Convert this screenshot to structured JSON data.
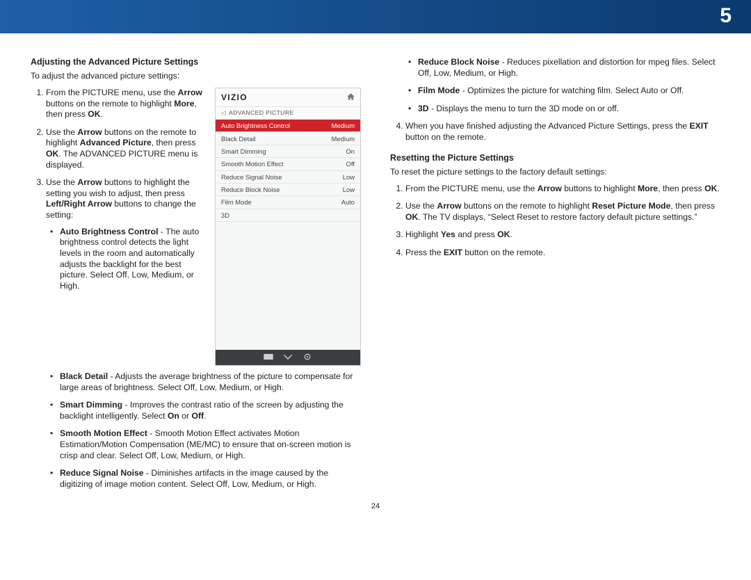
{
  "header": {
    "chapter_number": "5"
  },
  "page_number": "24",
  "screen": {
    "brand": "VIZIO",
    "crumb": "ADVANCED PICTURE",
    "rows": [
      {
        "label": "Auto Brightness Control",
        "value": "Medium",
        "selected": true
      },
      {
        "label": "Black Detail",
        "value": "Medium",
        "selected": false
      },
      {
        "label": "Smart Dimming",
        "value": "On",
        "selected": false
      },
      {
        "label": "Smooth Motion Effect",
        "value": "Off",
        "selected": false
      },
      {
        "label": "Reduce Signal Noise",
        "value": "Low",
        "selected": false
      },
      {
        "label": "Reduce Block Noise",
        "value": "Low",
        "selected": false
      },
      {
        "label": "Film Mode",
        "value": "Auto",
        "selected": false
      },
      {
        "label": "3D",
        "value": "",
        "selected": false
      }
    ]
  },
  "left": {
    "title": "Adjusting the Advanced Picture Settings",
    "intro": "To adjust the advanced picture settings:",
    "step1_a": "From the PICTURE menu, use the ",
    "step1_b": "Arrow",
    "step1_c": " buttons on the remote to highlight ",
    "step1_d": "More",
    "step1_e": ", then press ",
    "step1_f": "OK",
    "step1_g": ".",
    "step2_a": "Use the ",
    "step2_b": "Arrow",
    "step2_c": " buttons on the remote to highlight ",
    "step2_d": "Advanced Picture",
    "step2_e": ", then press ",
    "step2_f": "OK",
    "step2_g": ". The ADVANCED PICTURE menu is displayed.",
    "step3_a": "Use the ",
    "step3_b": "Arrow",
    "step3_c": " buttons to highlight the setting you wish to adjust, then press ",
    "step3_d": "Left/Right Arrow",
    "step3_e": " buttons to change the setting:",
    "opt1_h": "Auto Brightness Control",
    "opt1_t": " - The auto brightness control detects the light levels in the room and automatically adjusts the backlight for the best picture. Select Off, Low, Medium, or High.",
    "opt2_h": "Black Detail",
    "opt2_t": " - Adjusts the average brightness of the picture to compensate for large areas of brightness. Select Off, Low, Medium, or High.",
    "opt3_h": "Smart Dimming",
    "opt3_t1": " - Improves the contrast ratio of the screen by adjusting the backlight intelligently. Select ",
    "opt3_on": "On",
    "opt3_or": " or ",
    "opt3_off": "Off",
    "opt3_t2": ".",
    "opt4_h": "Smooth Motion Effect",
    "opt4_t": " - Smooth Motion Effect activates Motion Estimation/Motion Compensation (ME/MC) to ensure that on-screen motion is crisp and clear. Select Off, Low, Medium, or High.",
    "opt5_h": "Reduce Signal Noise",
    "opt5_t": " - Diminishes artifacts in the image caused by the digitizing of image motion content. Select Off, Low, Medium, or High."
  },
  "right": {
    "opt6_h": "Reduce Block Noise",
    "opt6_t": " - Reduces pixellation and distortion for mpeg files. Select Off, Low, Medium, or High.",
    "opt7_h": "Film Mode",
    "opt7_t": " - Optimizes the picture for watching film. Select Auto or Off.",
    "opt8_h": "3D",
    "opt8_t": " - Displays the menu to turn the 3D mode on or off.",
    "step4_a": "When you have finished adjusting the Advanced Picture Settings, press the ",
    "step4_b": "EXIT",
    "step4_c": " button on the remote.",
    "reset_title": "Resetting the Picture Settings",
    "reset_intro": "To reset the picture settings to the factory default settings:",
    "r1_a": "From the PICTURE menu, use the ",
    "r1_b": "Arrow",
    "r1_c": " buttons to highlight ",
    "r1_d": "More",
    "r1_e": ", then press ",
    "r1_f": "OK",
    "r1_g": ".",
    "r2_a": "Use the ",
    "r2_b": "Arrow",
    "r2_c": " buttons on the remote to highlight ",
    "r2_d": "Reset Picture Mode",
    "r2_e": ", then press ",
    "r2_f": "OK",
    "r2_g": ". The TV displays, “Select Reset to restore factory default picture settings.”",
    "r3_a": "Highlight ",
    "r3_b": "Yes",
    "r3_c": " and press ",
    "r3_d": "OK",
    "r3_e": ".",
    "r4_a": "Press the ",
    "r4_b": "EXIT",
    "r4_c": " button on the remote."
  }
}
